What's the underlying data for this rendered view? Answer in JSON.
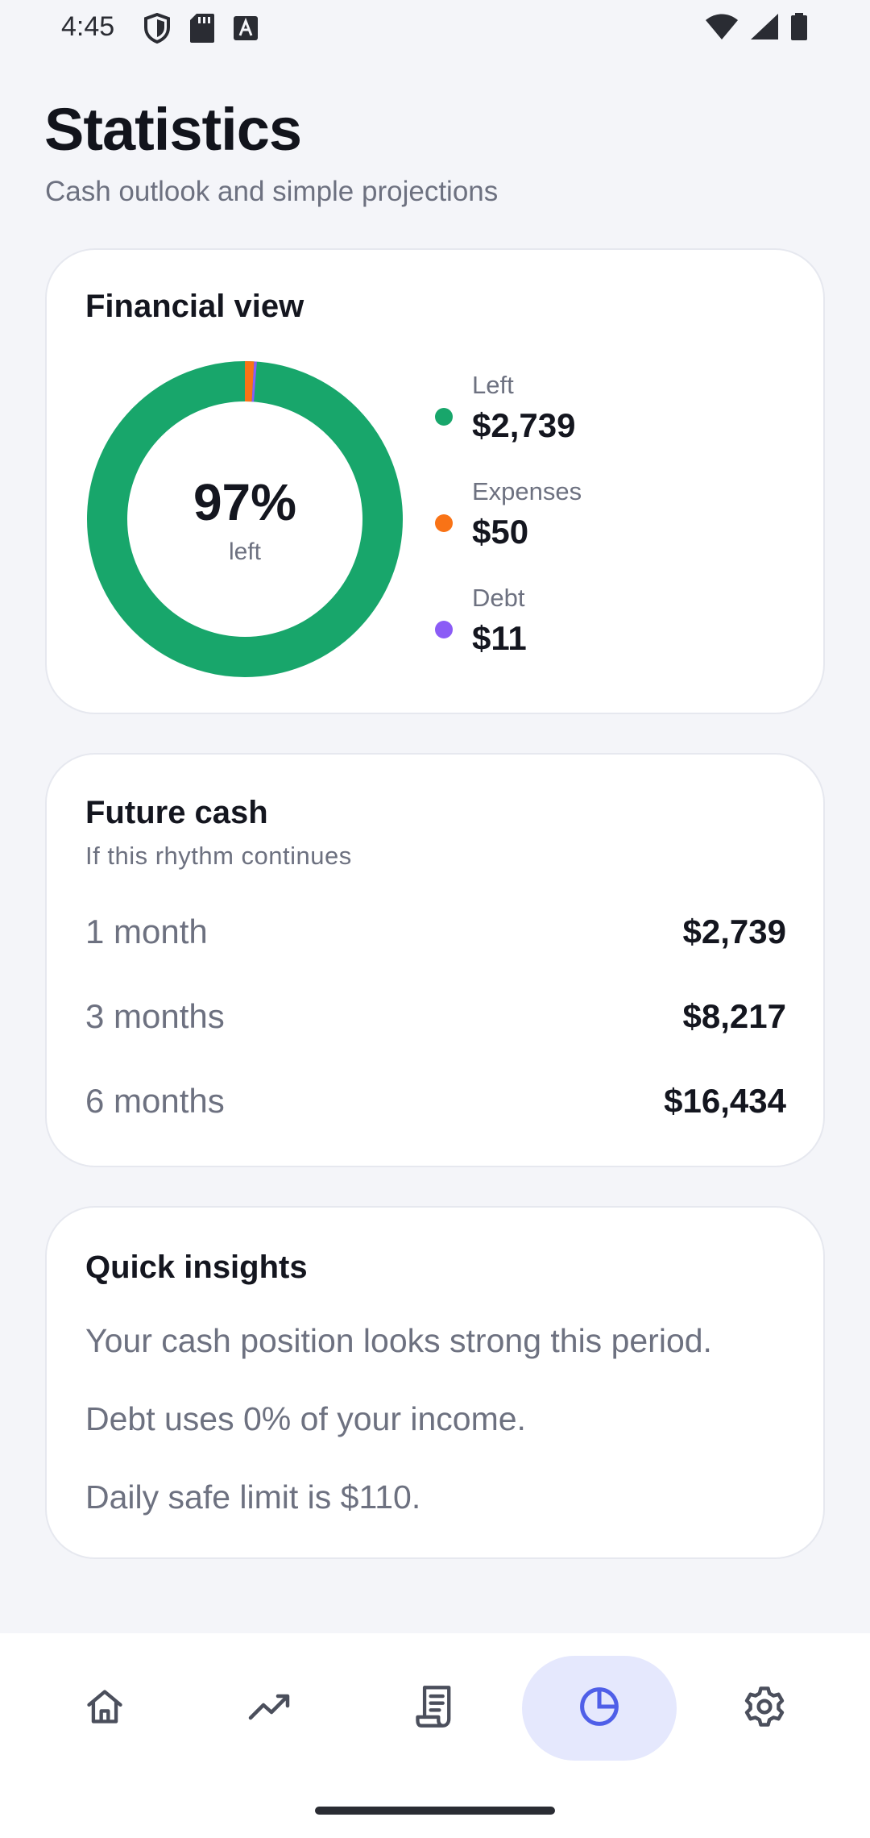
{
  "status_bar": {
    "time": "4:45"
  },
  "header": {
    "title": "Statistics",
    "subtitle": "Cash outlook and simple projections"
  },
  "financial_view": {
    "title": "Financial view",
    "center_value": "97%",
    "center_label": "left",
    "legend": [
      {
        "label": "Left",
        "value": "$2,739",
        "color": "#18a66b"
      },
      {
        "label": "Expenses",
        "value": "$50",
        "color": "#f97316"
      },
      {
        "label": "Debt",
        "value": "$11",
        "color": "#8b5cf6"
      }
    ]
  },
  "future_cash": {
    "title": "Future cash",
    "subtitle": "If this rhythm continues",
    "rows": [
      {
        "label": "1 month",
        "value": "$2,739"
      },
      {
        "label": "3 months",
        "value": "$8,217"
      },
      {
        "label": "6 months",
        "value": "$16,434"
      }
    ]
  },
  "insights": {
    "title": "Quick insights",
    "lines": [
      "Your cash position looks strong this period.",
      "Debt uses 0% of your income.",
      "Daily safe limit is $110."
    ]
  },
  "nav": {
    "items": [
      {
        "icon": "home-icon",
        "active": false
      },
      {
        "icon": "trending-up-icon",
        "active": false
      },
      {
        "icon": "receipt-icon",
        "active": false
      },
      {
        "icon": "pie-chart-icon",
        "active": true
      },
      {
        "icon": "gear-icon",
        "active": false
      }
    ],
    "active_color": "#4f5fe8",
    "inactive_color": "#4b4f5c"
  }
}
